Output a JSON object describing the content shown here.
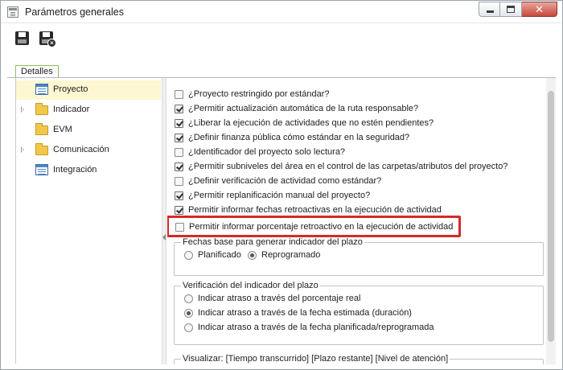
{
  "window": {
    "title": "Parámetros generales",
    "close_glyph": "✕",
    "icons": {
      "app": "window-icon",
      "minimize": "minimize-icon",
      "maximize": "maximize-icon",
      "close": "close-icon"
    }
  },
  "toolbar": {
    "save_icon": "save-icon",
    "save_close_icon": "save-and-close-icon",
    "badge_glyph": "×"
  },
  "tab": {
    "label": "Detalles"
  },
  "tree": {
    "items": [
      {
        "label": "Proyecto",
        "icon": "document-icon",
        "expandable": false,
        "selected": true
      },
      {
        "label": "Indicador",
        "icon": "folder-icon",
        "expandable": true,
        "selected": false
      },
      {
        "label": "EVM",
        "icon": "folder-icon",
        "expandable": false,
        "selected": false
      },
      {
        "label": "Comunicación",
        "icon": "folder-icon",
        "expandable": true,
        "selected": false
      },
      {
        "label": "Integración",
        "icon": "document-icon",
        "expandable": false,
        "selected": false
      }
    ]
  },
  "options": [
    {
      "label": "¿Proyecto restringido por estándar?",
      "checked": false
    },
    {
      "label": "¿Permitir actualización automática de la ruta responsable?",
      "checked": true
    },
    {
      "label": "¿Liberar la ejecución de actividades que no estén pendientes?",
      "checked": true
    },
    {
      "label": "¿Definir finanza pública cómo estándar en la seguridad?",
      "checked": true
    },
    {
      "label": "¿Identificador del proyecto solo lectura?",
      "checked": false
    },
    {
      "label": "¿Permitir subniveles del área en el control de las carpetas/atributos del proyecto?",
      "checked": true
    },
    {
      "label": "¿Definir verificación de actividad como estándar?",
      "checked": false
    },
    {
      "label": "¿Permitir replanificación manual del proyecto?",
      "checked": true
    },
    {
      "label": "Permitir informar fechas retroactivas en la ejecución de actividad",
      "checked": true
    }
  ],
  "highlighted_option": {
    "label": "Permitir informar porcentaje retroactivo en la ejecución de actividad",
    "checked": false,
    "highlight_color": "#d42a2a"
  },
  "groups": {
    "base_dates": {
      "legend": "Fechas base para generar indicador del plazo",
      "options": [
        {
          "label": "Planificado",
          "selected": false
        },
        {
          "label": "Reprogramado",
          "selected": true
        }
      ]
    },
    "verification": {
      "legend": "Verificación del indicador del plazo",
      "options": [
        {
          "label": "Indicar atraso a través del porcentaje real",
          "selected": false
        },
        {
          "label": "Indicar atraso a través de la fecha estimada (duración)",
          "selected": true
        },
        {
          "label": "Indicar atraso a través de la fecha planificada/reprogramada",
          "selected": false
        }
      ]
    },
    "visualize": {
      "legend": "Visualizar: [Tiempo transcurrido] [Plazo restante] [Nivel de atención]"
    }
  }
}
